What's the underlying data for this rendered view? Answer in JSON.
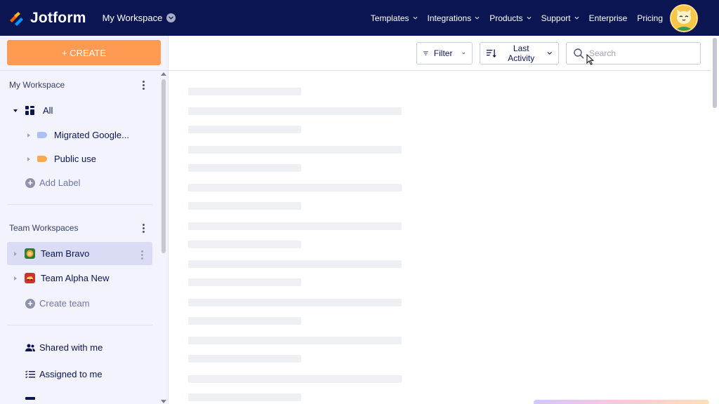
{
  "header": {
    "brand": "Jotform",
    "workspace_label": "My Workspace",
    "nav": [
      {
        "label": "Templates",
        "has_dropdown": true
      },
      {
        "label": "Integrations",
        "has_dropdown": true
      },
      {
        "label": "Products",
        "has_dropdown": true
      },
      {
        "label": "Support",
        "has_dropdown": true
      },
      {
        "label": "Enterprise",
        "has_dropdown": false
      },
      {
        "label": "Pricing",
        "has_dropdown": false
      }
    ],
    "avatar_icon": "cat-avatar"
  },
  "sidebar": {
    "create_label": "+ CREATE",
    "my_workspace": {
      "title": "My Workspace",
      "all_label": "All",
      "labels": [
        {
          "name": "Migrated Google...",
          "color": "#a9c1f5"
        },
        {
          "name": "Public use",
          "color": "#ffa94d"
        }
      ],
      "add_label": "Add Label"
    },
    "team_workspaces": {
      "title": "Team Workspaces",
      "teams": [
        {
          "name": "Team Bravo",
          "icon": "lion-icon",
          "color": "#2e7d32",
          "active": true
        },
        {
          "name": "Team Alpha New",
          "icon": "car-icon",
          "color": "#d32f2f",
          "active": false
        }
      ],
      "create_team": "Create team"
    },
    "links": [
      {
        "label": "Shared with me",
        "icon": "users-icon"
      },
      {
        "label": "Assigned to me",
        "icon": "checklist-icon"
      }
    ]
  },
  "toolbar": {
    "filter_label": "Filter",
    "sort_label": "Last Activity",
    "search_placeholder": "Search",
    "search_value": ""
  },
  "colors": {
    "nav_bg": "#0a1551",
    "create_bg": "#ff9a52",
    "sidebar_bg": "#f3f3fe",
    "active_item_bg": "#dadcf5"
  }
}
